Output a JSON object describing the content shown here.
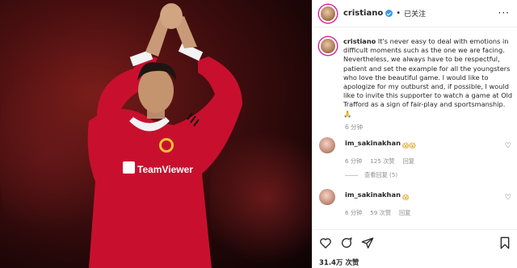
{
  "header": {
    "username": "cristiano",
    "separator": "•",
    "follow_status": "已关注",
    "more": "···"
  },
  "caption": {
    "username": "cristiano",
    "text": " It's never easy to deal with emotions in difficult moments such as the one we are facing. Nevertheless, we always have to be respectful, patient and set the example for all the youngsters who love the beautiful game. I would like to apologize for my outburst and, if possible, I would like to invite this supporter to watch a game at Old Trafford as a sign of fair-play and sportsmanship.",
    "emoji": "🙏",
    "time": "6 分钟"
  },
  "comments": [
    {
      "username": "im_sakinakhan",
      "emoji": "😱😱",
      "time": "6 分钟",
      "likes": "125 次赞",
      "reply": "回复",
      "view_replies": "查看回复 (5)"
    },
    {
      "username": "im_sakinakhan",
      "emoji": "😱",
      "time": "6 分钟",
      "likes": "59 次赞",
      "reply": "回复"
    }
  ],
  "footer": {
    "likes_count": "31.4万 次赞"
  },
  "icons": [
    "like-icon",
    "comment-icon",
    "share-icon",
    "bookmark-icon",
    "heart-icon",
    "verified-icon",
    "more-icon"
  ],
  "colors": {
    "accent": "#3897f0",
    "jersey_red": "#c8102e",
    "muted": "#8e8e8e"
  }
}
